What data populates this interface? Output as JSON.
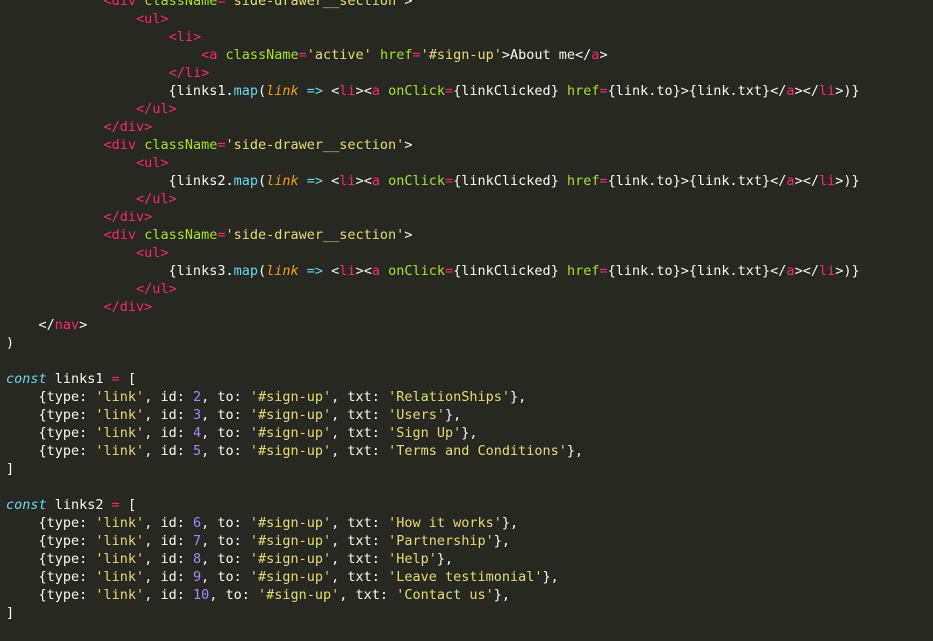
{
  "editor": {
    "theme": "monokai",
    "colors": {
      "background": "#272822",
      "tag": "#F92672",
      "attribute": "#A6E22E",
      "string": "#E6DB74",
      "function": "#66D9EF",
      "parameter": "#FD971F",
      "number": "#AE81FF",
      "text": "#F8F8F2"
    },
    "lines": [
      [
        [
          "plain",
          "            "
        ],
        [
          "kw-tag",
          "<div"
        ],
        [
          "plain",
          " "
        ],
        [
          "attr",
          "className"
        ],
        [
          "op",
          "="
        ],
        [
          "str",
          "'side-drawer__section'"
        ],
        [
          "plain",
          ">"
        ]
      ],
      [
        [
          "plain",
          "                "
        ],
        [
          "kw-tag",
          "<ul>"
        ]
      ],
      [
        [
          "plain",
          "                    "
        ],
        [
          "kw-tag",
          "<li>"
        ]
      ],
      [
        [
          "plain",
          "                        "
        ],
        [
          "kw-tag",
          "<a"
        ],
        [
          "plain",
          " "
        ],
        [
          "attr",
          "className"
        ],
        [
          "op",
          "="
        ],
        [
          "str",
          "'active'"
        ],
        [
          "plain",
          " "
        ],
        [
          "attr",
          "href"
        ],
        [
          "op",
          "="
        ],
        [
          "str",
          "'#sign-up'"
        ],
        [
          "plain",
          ">About me</"
        ],
        [
          "kw-tag",
          "a"
        ],
        [
          "plain",
          ">"
        ]
      ],
      [
        [
          "plain",
          "                    "
        ],
        [
          "kw-tag",
          "</li>"
        ]
      ],
      [
        [
          "plain",
          "                    {links1."
        ],
        [
          "fn",
          "map"
        ],
        [
          "plain",
          "("
        ],
        [
          "param",
          "link"
        ],
        [
          "plain",
          " "
        ],
        [
          "arrow",
          "=>"
        ],
        [
          "plain",
          " <"
        ],
        [
          "kw-tag",
          "li"
        ],
        [
          "plain",
          "><"
        ],
        [
          "kw-tag",
          "a"
        ],
        [
          "plain",
          " "
        ],
        [
          "attr",
          "onClick"
        ],
        [
          "op",
          "="
        ],
        [
          "plain",
          "{linkClicked} "
        ],
        [
          "attr",
          "href"
        ],
        [
          "op",
          "="
        ],
        [
          "plain",
          "{link.to}>{link.txt}</"
        ],
        [
          "kw-tag",
          "a"
        ],
        [
          "plain",
          "></"
        ],
        [
          "kw-tag",
          "li"
        ],
        [
          "plain",
          ">)}"
        ]
      ],
      [
        [
          "plain",
          "                "
        ],
        [
          "kw-tag",
          "</ul>"
        ]
      ],
      [
        [
          "plain",
          "            "
        ],
        [
          "kw-tag",
          "</div>"
        ]
      ],
      [
        [
          "plain",
          "            "
        ],
        [
          "kw-tag",
          "<div"
        ],
        [
          "plain",
          " "
        ],
        [
          "attr",
          "className"
        ],
        [
          "op",
          "="
        ],
        [
          "str",
          "'side-drawer__section'"
        ],
        [
          "plain",
          ">"
        ]
      ],
      [
        [
          "plain",
          "                "
        ],
        [
          "kw-tag",
          "<ul>"
        ]
      ],
      [
        [
          "plain",
          "                    {links2."
        ],
        [
          "fn",
          "map"
        ],
        [
          "plain",
          "("
        ],
        [
          "param",
          "link"
        ],
        [
          "plain",
          " "
        ],
        [
          "arrow",
          "=>"
        ],
        [
          "plain",
          " <"
        ],
        [
          "kw-tag",
          "li"
        ],
        [
          "plain",
          "><"
        ],
        [
          "kw-tag",
          "a"
        ],
        [
          "plain",
          " "
        ],
        [
          "attr",
          "onClick"
        ],
        [
          "op",
          "="
        ],
        [
          "plain",
          "{linkClicked} "
        ],
        [
          "attr",
          "href"
        ],
        [
          "op",
          "="
        ],
        [
          "plain",
          "{link.to}>{link.txt}</"
        ],
        [
          "kw-tag",
          "a"
        ],
        [
          "plain",
          "></"
        ],
        [
          "kw-tag",
          "li"
        ],
        [
          "plain",
          ">)}"
        ]
      ],
      [
        [
          "plain",
          "                "
        ],
        [
          "kw-tag",
          "</ul>"
        ]
      ],
      [
        [
          "plain",
          "            "
        ],
        [
          "kw-tag",
          "</div>"
        ]
      ],
      [
        [
          "plain",
          "            "
        ],
        [
          "kw-tag",
          "<div"
        ],
        [
          "plain",
          " "
        ],
        [
          "attr",
          "className"
        ],
        [
          "op",
          "="
        ],
        [
          "str",
          "'side-drawer__section'"
        ],
        [
          "plain",
          ">"
        ]
      ],
      [
        [
          "plain",
          "                "
        ],
        [
          "kw-tag",
          "<ul>"
        ]
      ],
      [
        [
          "plain",
          "                    {links3."
        ],
        [
          "fn",
          "map"
        ],
        [
          "plain",
          "("
        ],
        [
          "param",
          "link"
        ],
        [
          "plain",
          " "
        ],
        [
          "arrow",
          "=>"
        ],
        [
          "plain",
          " <"
        ],
        [
          "kw-tag",
          "li"
        ],
        [
          "plain",
          "><"
        ],
        [
          "kw-tag",
          "a"
        ],
        [
          "plain",
          " "
        ],
        [
          "attr",
          "onClick"
        ],
        [
          "op",
          "="
        ],
        [
          "plain",
          "{linkClicked} "
        ],
        [
          "attr",
          "href"
        ],
        [
          "op",
          "="
        ],
        [
          "plain",
          "{link.to}>{link.txt}</"
        ],
        [
          "kw-tag",
          "a"
        ],
        [
          "plain",
          "></"
        ],
        [
          "kw-tag",
          "li"
        ],
        [
          "plain",
          ">)}"
        ]
      ],
      [
        [
          "plain",
          "                "
        ],
        [
          "kw-tag",
          "</ul>"
        ]
      ],
      [
        [
          "plain",
          "            "
        ],
        [
          "kw-tag",
          "</div>"
        ]
      ],
      [
        [
          "plain",
          "    </"
        ],
        [
          "kw-tag",
          "nav"
        ],
        [
          "plain",
          ">"
        ]
      ],
      [
        [
          "plain",
          ")"
        ]
      ],
      [
        [
          "plain",
          ""
        ]
      ],
      [
        [
          "storage",
          "const"
        ],
        [
          "plain",
          " links1 "
        ],
        [
          "op",
          "="
        ],
        [
          "plain",
          " ["
        ]
      ],
      [
        [
          "plain",
          "    {type: "
        ],
        [
          "str",
          "'link'"
        ],
        [
          "plain",
          ", id: "
        ],
        [
          "num",
          "2"
        ],
        [
          "plain",
          ", to: "
        ],
        [
          "str",
          "'#sign-up'"
        ],
        [
          "plain",
          ", txt: "
        ],
        [
          "str",
          "'RelationShips'"
        ],
        [
          "plain",
          "},"
        ]
      ],
      [
        [
          "plain",
          "    {type: "
        ],
        [
          "str",
          "'link'"
        ],
        [
          "plain",
          ", id: "
        ],
        [
          "num",
          "3"
        ],
        [
          "plain",
          ", to: "
        ],
        [
          "str",
          "'#sign-up'"
        ],
        [
          "plain",
          ", txt: "
        ],
        [
          "str",
          "'Users'"
        ],
        [
          "plain",
          "},"
        ]
      ],
      [
        [
          "plain",
          "    {type: "
        ],
        [
          "str",
          "'link'"
        ],
        [
          "plain",
          ", id: "
        ],
        [
          "num",
          "4"
        ],
        [
          "plain",
          ", to: "
        ],
        [
          "str",
          "'#sign-up'"
        ],
        [
          "plain",
          ", txt: "
        ],
        [
          "str",
          "'Sign Up'"
        ],
        [
          "plain",
          "},"
        ]
      ],
      [
        [
          "plain",
          "    {type: "
        ],
        [
          "str",
          "'link'"
        ],
        [
          "plain",
          ", id: "
        ],
        [
          "num",
          "5"
        ],
        [
          "plain",
          ", to: "
        ],
        [
          "str",
          "'#sign-up'"
        ],
        [
          "plain",
          ", txt: "
        ],
        [
          "str",
          "'Terms and Conditions'"
        ],
        [
          "plain",
          "},"
        ]
      ],
      [
        [
          "plain",
          "]"
        ]
      ],
      [
        [
          "plain",
          ""
        ]
      ],
      [
        [
          "storage",
          "const"
        ],
        [
          "plain",
          " links2 "
        ],
        [
          "op",
          "="
        ],
        [
          "plain",
          " ["
        ]
      ],
      [
        [
          "plain",
          "    {type: "
        ],
        [
          "str",
          "'link'"
        ],
        [
          "plain",
          ", id: "
        ],
        [
          "num",
          "6"
        ],
        [
          "plain",
          ", to: "
        ],
        [
          "str",
          "'#sign-up'"
        ],
        [
          "plain",
          ", txt: "
        ],
        [
          "str",
          "'How it works'"
        ],
        [
          "plain",
          "},"
        ]
      ],
      [
        [
          "plain",
          "    {type: "
        ],
        [
          "str",
          "'link'"
        ],
        [
          "plain",
          ", id: "
        ],
        [
          "num",
          "7"
        ],
        [
          "plain",
          ", to: "
        ],
        [
          "str",
          "'#sign-up'"
        ],
        [
          "plain",
          ", txt: "
        ],
        [
          "str",
          "'Partnership'"
        ],
        [
          "plain",
          "},"
        ]
      ],
      [
        [
          "plain",
          "    {type: "
        ],
        [
          "str",
          "'link'"
        ],
        [
          "plain",
          ", id: "
        ],
        [
          "num",
          "8"
        ],
        [
          "plain",
          ", to: "
        ],
        [
          "str",
          "'#sign-up'"
        ],
        [
          "plain",
          ", txt: "
        ],
        [
          "str",
          "'Help'"
        ],
        [
          "plain",
          "},"
        ]
      ],
      [
        [
          "plain",
          "    {type: "
        ],
        [
          "str",
          "'link'"
        ],
        [
          "plain",
          ", id: "
        ],
        [
          "num",
          "9"
        ],
        [
          "plain",
          ", to: "
        ],
        [
          "str",
          "'#sign-up'"
        ],
        [
          "plain",
          ", txt: "
        ],
        [
          "str",
          "'Leave testimonial'"
        ],
        [
          "plain",
          "},"
        ]
      ],
      [
        [
          "plain",
          "    {type: "
        ],
        [
          "str",
          "'link'"
        ],
        [
          "plain",
          ", id: "
        ],
        [
          "num",
          "10"
        ],
        [
          "plain",
          ", to: "
        ],
        [
          "str",
          "'#sign-up'"
        ],
        [
          "plain",
          ", txt: "
        ],
        [
          "str",
          "'Contact us'"
        ],
        [
          "plain",
          "},"
        ]
      ],
      [
        [
          "plain",
          "]"
        ]
      ]
    ]
  }
}
